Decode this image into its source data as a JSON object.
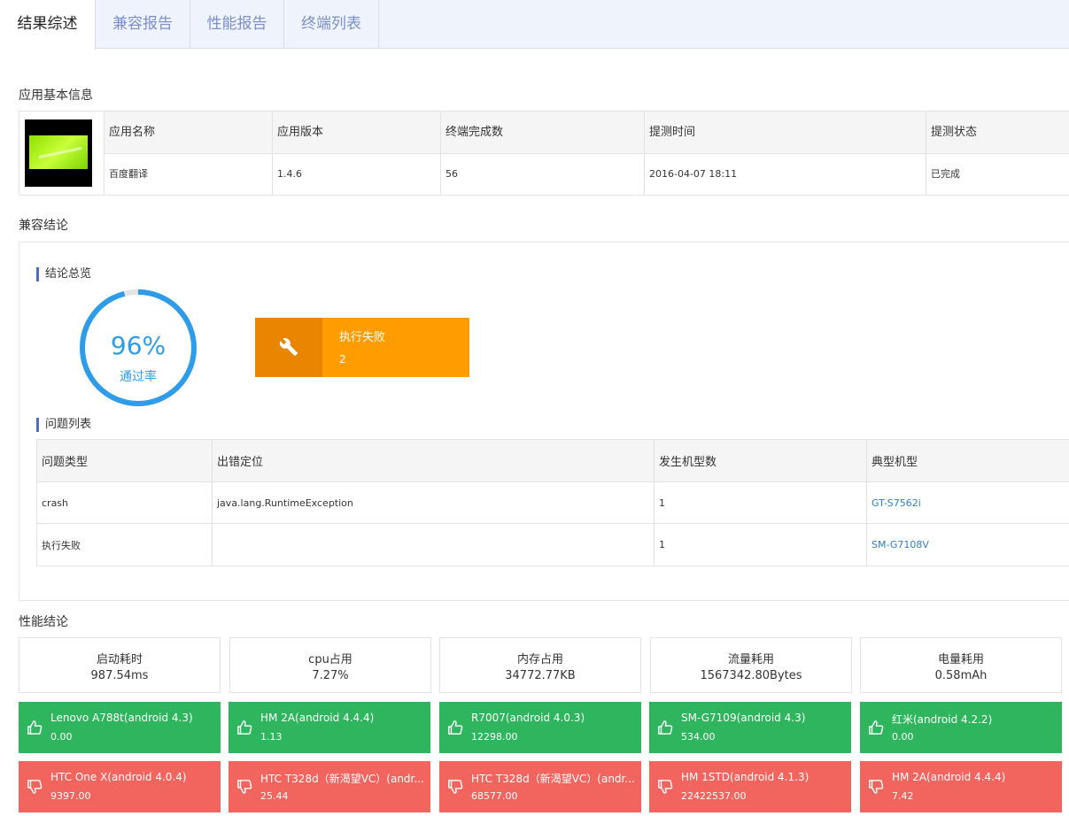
{
  "tabs": [
    {
      "label": "结果综述"
    },
    {
      "label": "兼容报告"
    },
    {
      "label": "性能报告"
    },
    {
      "label": "终端列表"
    }
  ],
  "app_info": {
    "title": "应用基本信息",
    "headers": [
      "应用名称",
      "应用版本",
      "终端完成数",
      "提测时间",
      "提测状态"
    ],
    "values": [
      "百度翻译",
      "1.4.6",
      "56",
      "2016-04-07 18:11",
      "已完成"
    ]
  },
  "compat": {
    "title": "兼容结论",
    "overview_title": "结论总览",
    "pass_rate": "96%",
    "pass_rate_value": 0.96,
    "pass_label": "通过率",
    "fail_label": "执行失败",
    "fail_count": "2",
    "issues_title": "问题列表",
    "issue_headers": [
      "问题类型",
      "出错定位",
      "发生机型数",
      "典型机型"
    ],
    "issues": [
      {
        "type": "crash",
        "location": "java.lang.RuntimeException",
        "count": "1",
        "model": "GT-S7562i"
      },
      {
        "type": "执行失败",
        "location": "",
        "count": "1",
        "model": "SM-G7108V"
      }
    ]
  },
  "perf": {
    "title": "性能结论",
    "metrics": [
      {
        "name": "启动耗时",
        "value": "987.54ms"
      },
      {
        "name": "cpu占用",
        "value": "7.27%"
      },
      {
        "name": "内存占用",
        "value": "34772.77KB"
      },
      {
        "name": "流量耗用",
        "value": "1567342.80Bytes"
      },
      {
        "name": "电量耗用",
        "value": "0.58mAh"
      }
    ],
    "best": [
      {
        "device": "Lenovo A788t(android 4.3)",
        "value": "0.00"
      },
      {
        "device": "HM 2A(android 4.4.4)",
        "value": "1.13"
      },
      {
        "device": "R7007(android 4.0.3)",
        "value": "12298.00"
      },
      {
        "device": "SM-G7109(android 4.3)",
        "value": "534.00"
      },
      {
        "device": "红米(android 4.2.2)",
        "value": "0.00"
      }
    ],
    "worst": [
      {
        "device": "HTC One X(android 4.0.4)",
        "value": "9397.00"
      },
      {
        "device": "HTC T328d（新渴望VC）(andr...",
        "value": "25.44"
      },
      {
        "device": "HTC T328d（新渴望VC）(andr...",
        "value": "68577.00"
      },
      {
        "device": "HM 1STD(android 4.1.3)",
        "value": "22422537.00"
      },
      {
        "device": "HM 2A(android 4.4.4)",
        "value": "7.42"
      }
    ]
  },
  "colors": {
    "accent": "#2e9ce8",
    "warning": "#ff9c00",
    "good": "#2fb55d",
    "bad": "#f2655f",
    "link": "#2f7dc9"
  }
}
